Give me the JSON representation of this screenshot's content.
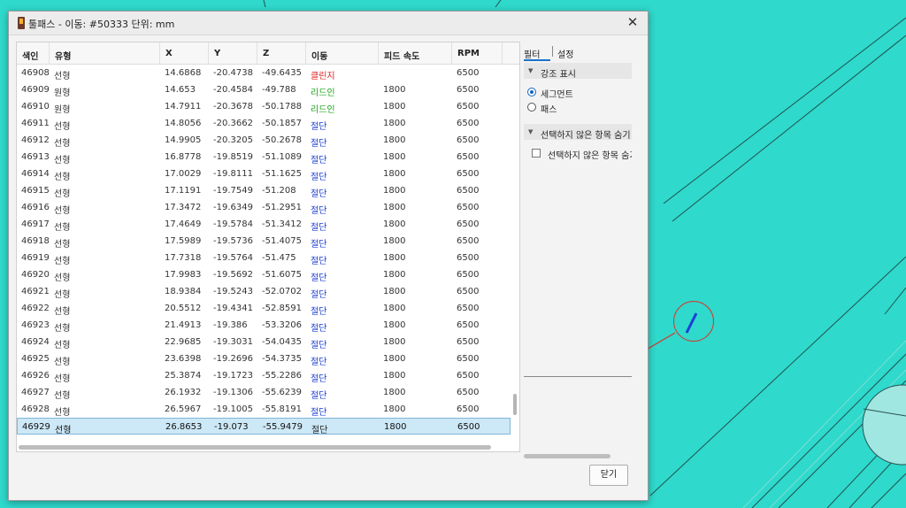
{
  "window": {
    "title": "툴패스 - 이동: #50333 단위: mm",
    "close_glyph": "✕"
  },
  "table": {
    "headers": [
      "색인",
      "유형",
      "X",
      "Y",
      "Z",
      "이동",
      "피드 속도",
      "RPM"
    ],
    "rows": [
      {
        "index": "46908",
        "type": "선형",
        "x": "14.6868",
        "y": "-20.4738",
        "z": "-49.6435",
        "move": "클린지",
        "feed": "",
        "rpm": "6500",
        "move_color": "#e02020"
      },
      {
        "index": "46909",
        "type": "원형",
        "x": "14.653",
        "y": "-20.4584",
        "z": "-49.788",
        "move": "리드인",
        "feed": "1800",
        "rpm": "6500",
        "move_color": "#1aa31a"
      },
      {
        "index": "46910",
        "type": "원형",
        "x": "14.7911",
        "y": "-20.3678",
        "z": "-50.1788",
        "move": "리드인",
        "feed": "1800",
        "rpm": "6500",
        "move_color": "#1aa31a"
      },
      {
        "index": "46911",
        "type": "선형",
        "x": "14.8056",
        "y": "-20.3662",
        "z": "-50.1857",
        "move": "절단",
        "feed": "1800",
        "rpm": "6500",
        "move_color": "#1d3fd6"
      },
      {
        "index": "46912",
        "type": "선형",
        "x": "14.9905",
        "y": "-20.3205",
        "z": "-50.2678",
        "move": "절단",
        "feed": "1800",
        "rpm": "6500",
        "move_color": "#1d3fd6"
      },
      {
        "index": "46913",
        "type": "선형",
        "x": "16.8778",
        "y": "-19.8519",
        "z": "-51.1089",
        "move": "절단",
        "feed": "1800",
        "rpm": "6500",
        "move_color": "#1d3fd6"
      },
      {
        "index": "46914",
        "type": "선형",
        "x": "17.0029",
        "y": "-19.8111",
        "z": "-51.1625",
        "move": "절단",
        "feed": "1800",
        "rpm": "6500",
        "move_color": "#1d3fd6"
      },
      {
        "index": "46915",
        "type": "선형",
        "x": "17.1191",
        "y": "-19.7549",
        "z": "-51.208",
        "move": "절단",
        "feed": "1800",
        "rpm": "6500",
        "move_color": "#1d3fd6"
      },
      {
        "index": "46916",
        "type": "선형",
        "x": "17.3472",
        "y": "-19.6349",
        "z": "-51.2951",
        "move": "절단",
        "feed": "1800",
        "rpm": "6500",
        "move_color": "#1d3fd6"
      },
      {
        "index": "46917",
        "type": "선형",
        "x": "17.4649",
        "y": "-19.5784",
        "z": "-51.3412",
        "move": "절단",
        "feed": "1800",
        "rpm": "6500",
        "move_color": "#1d3fd6"
      },
      {
        "index": "46918",
        "type": "선형",
        "x": "17.5989",
        "y": "-19.5736",
        "z": "-51.4075",
        "move": "절단",
        "feed": "1800",
        "rpm": "6500",
        "move_color": "#1d3fd6"
      },
      {
        "index": "46919",
        "type": "선형",
        "x": "17.7318",
        "y": "-19.5764",
        "z": "-51.475",
        "move": "절단",
        "feed": "1800",
        "rpm": "6500",
        "move_color": "#1d3fd6"
      },
      {
        "index": "46920",
        "type": "선형",
        "x": "17.9983",
        "y": "-19.5692",
        "z": "-51.6075",
        "move": "절단",
        "feed": "1800",
        "rpm": "6500",
        "move_color": "#1d3fd6"
      },
      {
        "index": "46921",
        "type": "선형",
        "x": "18.9384",
        "y": "-19.5243",
        "z": "-52.0702",
        "move": "절단",
        "feed": "1800",
        "rpm": "6500",
        "move_color": "#1d3fd6"
      },
      {
        "index": "46922",
        "type": "선형",
        "x": "20.5512",
        "y": "-19.4341",
        "z": "-52.8591",
        "move": "절단",
        "feed": "1800",
        "rpm": "6500",
        "move_color": "#1d3fd6"
      },
      {
        "index": "46923",
        "type": "선형",
        "x": "21.4913",
        "y": "-19.386",
        "z": "-53.3206",
        "move": "절단",
        "feed": "1800",
        "rpm": "6500",
        "move_color": "#1d3fd6"
      },
      {
        "index": "46924",
        "type": "선형",
        "x": "22.9685",
        "y": "-19.3031",
        "z": "-54.0435",
        "move": "절단",
        "feed": "1800",
        "rpm": "6500",
        "move_color": "#1d3fd6"
      },
      {
        "index": "46925",
        "type": "선형",
        "x": "23.6398",
        "y": "-19.2696",
        "z": "-54.3735",
        "move": "절단",
        "feed": "1800",
        "rpm": "6500",
        "move_color": "#1d3fd6"
      },
      {
        "index": "46926",
        "type": "선형",
        "x": "25.3874",
        "y": "-19.1723",
        "z": "-55.2286",
        "move": "절단",
        "feed": "1800",
        "rpm": "6500",
        "move_color": "#1d3fd6"
      },
      {
        "index": "46927",
        "type": "선형",
        "x": "26.1932",
        "y": "-19.1306",
        "z": "-55.6239",
        "move": "절단",
        "feed": "1800",
        "rpm": "6500",
        "move_color": "#1d3fd6"
      },
      {
        "index": "46928",
        "type": "선형",
        "x": "26.5967",
        "y": "-19.1005",
        "z": "-55.8191",
        "move": "절단",
        "feed": "1800",
        "rpm": "6500",
        "move_color": "#1d3fd6"
      },
      {
        "index": "46929",
        "type": "선형",
        "x": "26.8653",
        "y": "-19.073",
        "z": "-55.9479",
        "move": "절단",
        "feed": "1800",
        "rpm": "6500",
        "move_color": "#222222",
        "selected": true
      }
    ]
  },
  "side": {
    "tabs": [
      "필터",
      "설정"
    ],
    "highlight_section": "강조 표시",
    "radio_segment": "세그먼트",
    "radio_path": "패스",
    "hide_section": "선택하지 않은 항목 숨기",
    "hide_checkbox": "선택하지 않은 항목 숨기"
  },
  "footer": {
    "close_button": "닫기"
  },
  "colors": {
    "background": "#2fd9cc",
    "annotation": "#d23a2c",
    "selected_row": "#cde8f6"
  }
}
